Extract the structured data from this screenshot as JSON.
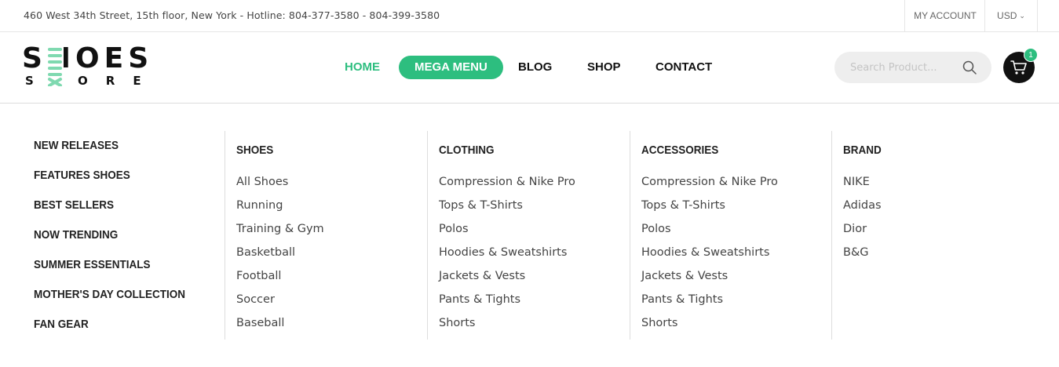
{
  "topbar": {
    "address": "460 West 34th Street, 15th floor, New York - Hotline: 804-377-3580 - 804-399-3580",
    "account_label": "MY ACCOUNT",
    "currency_label": "USD"
  },
  "logo": {
    "line1": "SHOES",
    "line2": "STORE"
  },
  "nav": {
    "items": [
      {
        "label": "HOME",
        "state": "active"
      },
      {
        "label": "MEGA MENU",
        "state": "highlighted"
      },
      {
        "label": "BLOG"
      },
      {
        "label": "SHOP"
      },
      {
        "label": "CONTACT"
      }
    ]
  },
  "search": {
    "placeholder": "Search Product..."
  },
  "cart": {
    "count": "1"
  },
  "colors": {
    "accent": "#2dbe7f",
    "dark": "#111111"
  },
  "mega_menu": {
    "featured": [
      "NEW RELEASES",
      "FEATURES SHOES",
      "BEST SELLERS",
      "NOW TRENDING",
      "SUMMER ESSENTIALS",
      "MOTHER'S DAY COLLECTION",
      "FAN GEAR"
    ],
    "columns": [
      {
        "title": "SHOES",
        "links": [
          "All Shoes",
          "Running",
          "Training & Gym",
          "Basketball",
          "Football",
          "Soccer",
          "Baseball"
        ]
      },
      {
        "title": "CLOTHING",
        "links": [
          "Compression & Nike Pro",
          "Tops & T-Shirts",
          "Polos",
          "Hoodies & Sweatshirts",
          "Jackets & Vests",
          "Pants & Tights",
          "Shorts"
        ]
      },
      {
        "title": "ACCESSORIES",
        "links": [
          "Compression & Nike Pro",
          "Tops & T-Shirts",
          "Polos",
          "Hoodies & Sweatshirts",
          "Jackets & Vests",
          "Pants & Tights",
          "Shorts"
        ]
      },
      {
        "title": "BRAND",
        "links": [
          "NIKE",
          "Adidas",
          "Dior",
          "B&G"
        ]
      }
    ]
  }
}
